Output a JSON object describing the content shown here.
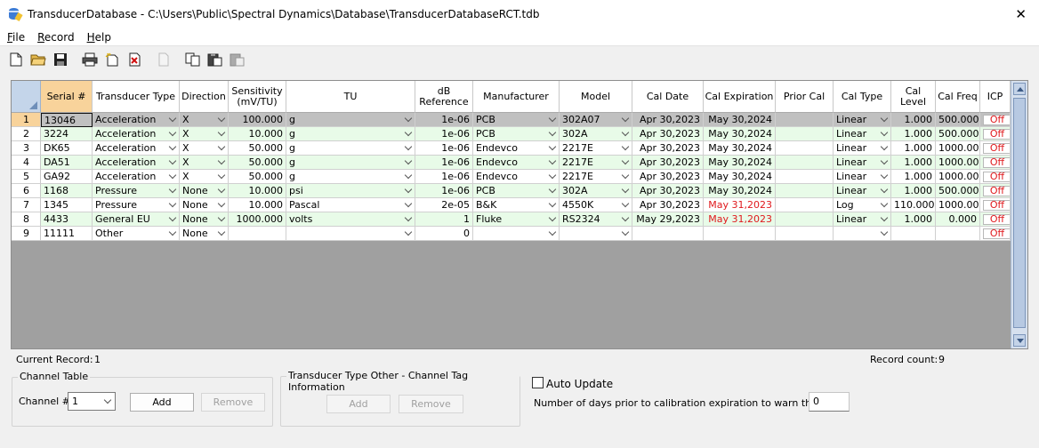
{
  "window": {
    "title": "TransducerDatabase - C:\\Users\\Public\\Spectral Dynamics\\Database\\TransducerDatabaseRCT.tdb",
    "close_glyph": "✕"
  },
  "menu": [
    {
      "label": "File",
      "underline": "F",
      "rest": "ile"
    },
    {
      "label": "Record",
      "underline": "R",
      "rest": "ecord"
    },
    {
      "label": "Help",
      "underline": "H",
      "rest": "elp"
    }
  ],
  "toolbar_icons": [
    "new-file-icon",
    "open-folder-icon",
    "save-icon",
    "print-icon",
    "new-record-icon",
    "delete-record-icon",
    "blank-page-icon",
    "copy-icon",
    "paste-icon",
    "paste-special-icon"
  ],
  "grid": {
    "headers": [
      "Serial #",
      "Transducer Type",
      "Direction",
      "Sensitivity (mV/TU)",
      "TU",
      "dB Reference",
      "Manufacturer",
      "Model",
      "Cal Date",
      "Cal Expiration",
      "Prior Cal",
      "Cal Type",
      "Cal Level",
      "Cal Freq",
      "ICP"
    ],
    "rows": [
      {
        "num": "1",
        "serial": "13046",
        "type": "Acceleration",
        "dir": "X",
        "sens": "100.000",
        "tu": "g",
        "db": "1e-06",
        "mfr": "PCB",
        "model": "302A07",
        "cal_date": "Apr 30,2023",
        "cal_exp": "May 30,2024",
        "exp_warn": false,
        "prior": "",
        "cal_type": "Linear",
        "cal_level": "1.000",
        "cal_freq": "500.000",
        "icp": "Off",
        "selected": true
      },
      {
        "num": "2",
        "serial": "3224",
        "type": "Acceleration",
        "dir": "X",
        "sens": "10.000",
        "tu": "g",
        "db": "1e-06",
        "mfr": "PCB",
        "model": "302A",
        "cal_date": "Apr 30,2023",
        "cal_exp": "May 30,2024",
        "exp_warn": false,
        "prior": "",
        "cal_type": "Linear",
        "cal_level": "1.000",
        "cal_freq": "500.000",
        "icp": "Off"
      },
      {
        "num": "3",
        "serial": "DK65",
        "type": "Acceleration",
        "dir": "X",
        "sens": "50.000",
        "tu": "g",
        "db": "1e-06",
        "mfr": "Endevco",
        "model": "2217E",
        "cal_date": "Apr 30,2023",
        "cal_exp": "May 30,2024",
        "exp_warn": false,
        "prior": "",
        "cal_type": "Linear",
        "cal_level": "1.000",
        "cal_freq": "1000.000",
        "icp": "Off"
      },
      {
        "num": "4",
        "serial": "DA51",
        "type": "Acceleration",
        "dir": "X",
        "sens": "50.000",
        "tu": "g",
        "db": "1e-06",
        "mfr": "Endevco",
        "model": "2217E",
        "cal_date": "Apr 30,2023",
        "cal_exp": "May 30,2024",
        "exp_warn": false,
        "prior": "",
        "cal_type": "Linear",
        "cal_level": "1.000",
        "cal_freq": "1000.000",
        "icp": "Off"
      },
      {
        "num": "5",
        "serial": "GA92",
        "type": "Acceleration",
        "dir": "X",
        "sens": "50.000",
        "tu": "g",
        "db": "1e-06",
        "mfr": "Endevco",
        "model": "2217E",
        "cal_date": "Apr 30,2023",
        "cal_exp": "May 30,2024",
        "exp_warn": false,
        "prior": "",
        "cal_type": "Linear",
        "cal_level": "1.000",
        "cal_freq": "1000.000",
        "icp": "Off"
      },
      {
        "num": "6",
        "serial": "1168",
        "type": "Pressure",
        "dir": "None",
        "sens": "10.000",
        "tu": "psi",
        "db": "1e-06",
        "mfr": "PCB",
        "model": "302A",
        "cal_date": "Apr 30,2023",
        "cal_exp": "May 30,2024",
        "exp_warn": false,
        "prior": "",
        "cal_type": "Linear",
        "cal_level": "1.000",
        "cal_freq": "500.000",
        "icp": "Off"
      },
      {
        "num": "7",
        "serial": "1345",
        "type": "Pressure",
        "dir": "None",
        "sens": "10.000",
        "tu": "Pascal",
        "db": "2e-05",
        "mfr": "B&K",
        "model": "4550K",
        "cal_date": "Apr 30,2023",
        "cal_exp": "May 31,2023",
        "exp_warn": true,
        "prior": "",
        "cal_type": "Log",
        "cal_level": "110.000",
        "cal_freq": "1000.000",
        "icp": "Off"
      },
      {
        "num": "8",
        "serial": "4433",
        "type": "General EU",
        "dir": "None",
        "sens": "1000.000",
        "tu": "volts",
        "db": "1",
        "mfr": "Fluke",
        "model": "RS2324",
        "cal_date": "May 29,2023",
        "cal_exp": "May 31,2023",
        "exp_warn": true,
        "prior": "",
        "cal_type": "Linear",
        "cal_level": "1.000",
        "cal_freq": "0.000",
        "icp": "Off"
      },
      {
        "num": "9",
        "serial": "11111",
        "type": "Other",
        "dir": "None",
        "sens": "",
        "tu": "",
        "db": "0",
        "mfr": "",
        "model": "",
        "cal_date": "",
        "cal_exp": "",
        "exp_warn": false,
        "prior": "",
        "cal_type": "",
        "cal_level": "",
        "cal_freq": "",
        "icp": "Off"
      }
    ]
  },
  "status": {
    "current_record_label": "Current Record:",
    "current_record_value": "1",
    "record_count_label": "Record count:",
    "record_count_value": "9"
  },
  "channel_table": {
    "title": "Channel Table",
    "channel_label": "Channel #",
    "channel_value": "1",
    "add_label": "Add",
    "remove_label": "Remove"
  },
  "tag_info": {
    "title": "Transducer Type Other - Channel Tag Information",
    "add_label": "Add",
    "remove_label": "Remove"
  },
  "auto_update": {
    "label": "Auto Update",
    "checked": false
  },
  "warn_days": {
    "label": "Number of days prior to calibration expiration to warn the user:",
    "value": "0"
  },
  "colors": {
    "row_green": "#e8fbe8",
    "row_white": "#ffffff",
    "row_selected": "#c0c0c0",
    "empty_area": "#a0a0a0",
    "warn_red": "#e0191d",
    "header_selected": "#f8d39b"
  }
}
